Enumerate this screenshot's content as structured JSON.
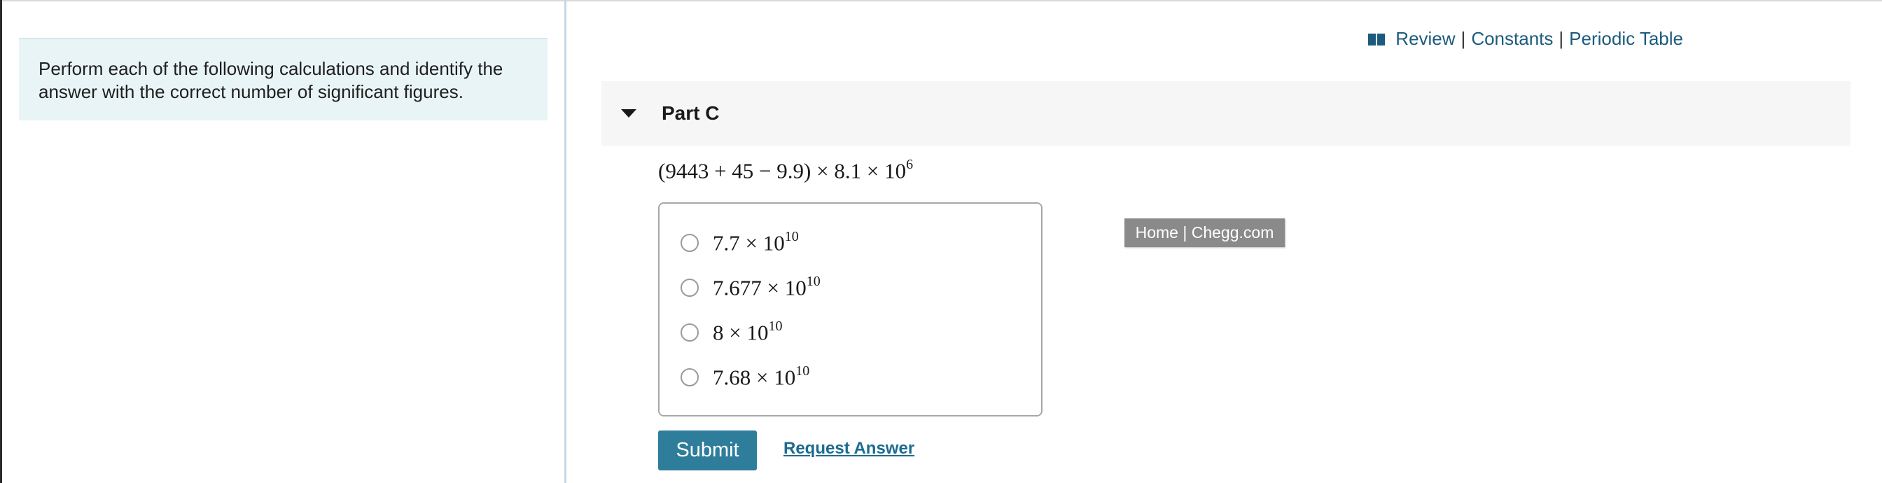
{
  "intro": {
    "text": "Perform each of the following calculations and identify the answer with the correct number of significant figures."
  },
  "toolbar": {
    "review": "Review",
    "constants": "Constants",
    "periodic_table": "Periodic Table",
    "separator": "|"
  },
  "part": {
    "title": "Part C"
  },
  "question": {
    "expression_base": "(9443 + 45 − 9.9) × 8.1 × 10",
    "expression_exp": "6"
  },
  "choices": [
    {
      "mantissa": "7.7 × 10",
      "exponent": "10"
    },
    {
      "mantissa": "7.677 × 10",
      "exponent": "10"
    },
    {
      "mantissa": "8 × 10",
      "exponent": "10"
    },
    {
      "mantissa": "7.68 × 10",
      "exponent": "10"
    }
  ],
  "tooltip": {
    "text": "Home | Chegg.com"
  },
  "actions": {
    "submit_label": "Submit",
    "request_answer_label": "Request Answer"
  },
  "icons": {
    "book": "book-icon",
    "caret": "caret-down-icon",
    "radio": "radio-unchecked-icon"
  },
  "colors": {
    "link": "#1c5b7e",
    "submit_bg": "#2e7d9b",
    "intro_bg": "#e9f4f6",
    "header_bg": "#f6f6f6",
    "tooltip_bg": "#8a8a8a"
  }
}
